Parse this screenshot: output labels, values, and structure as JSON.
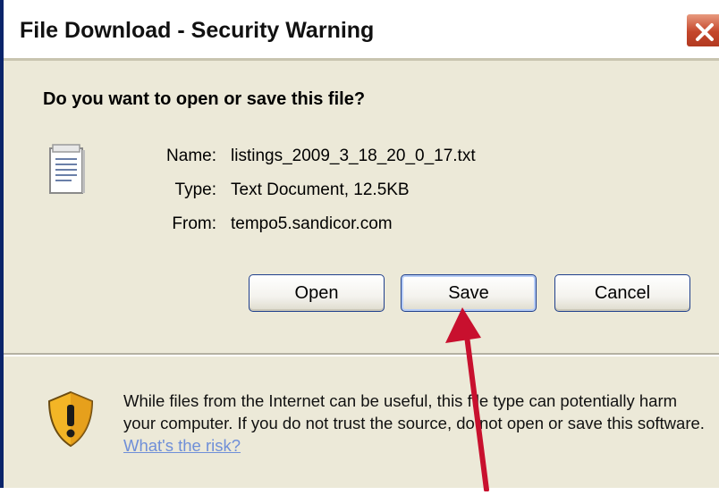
{
  "window": {
    "title": "File Download - Security Warning",
    "close_icon": "close-icon"
  },
  "prompt": {
    "question": "Do you want to open or save this file?"
  },
  "file": {
    "icon": "text-file-icon",
    "name_label": "Name:",
    "name_value": "listings_2009_3_18_20_0_17.txt",
    "type_label": "Type:",
    "type_value": "Text Document, 12.5KB",
    "from_label": "From:",
    "from_value": "tempo5.sandicor.com"
  },
  "buttons": {
    "open": "Open",
    "save": "Save",
    "cancel": "Cancel"
  },
  "warning": {
    "icon": "shield-warning-icon",
    "text": "While files from the Internet can be useful, this file type can potentially harm your computer. If you do not trust the source, do not open or save this software.",
    "link": "What's the risk?"
  },
  "annotation": {
    "icon": "red-arrow-icon",
    "color": "#c8102e"
  },
  "colors": {
    "dialog_bg": "#ece9d8",
    "button_border": "#1f3f8c",
    "link": "#6f8fd8",
    "close_button": "#c4462b"
  }
}
